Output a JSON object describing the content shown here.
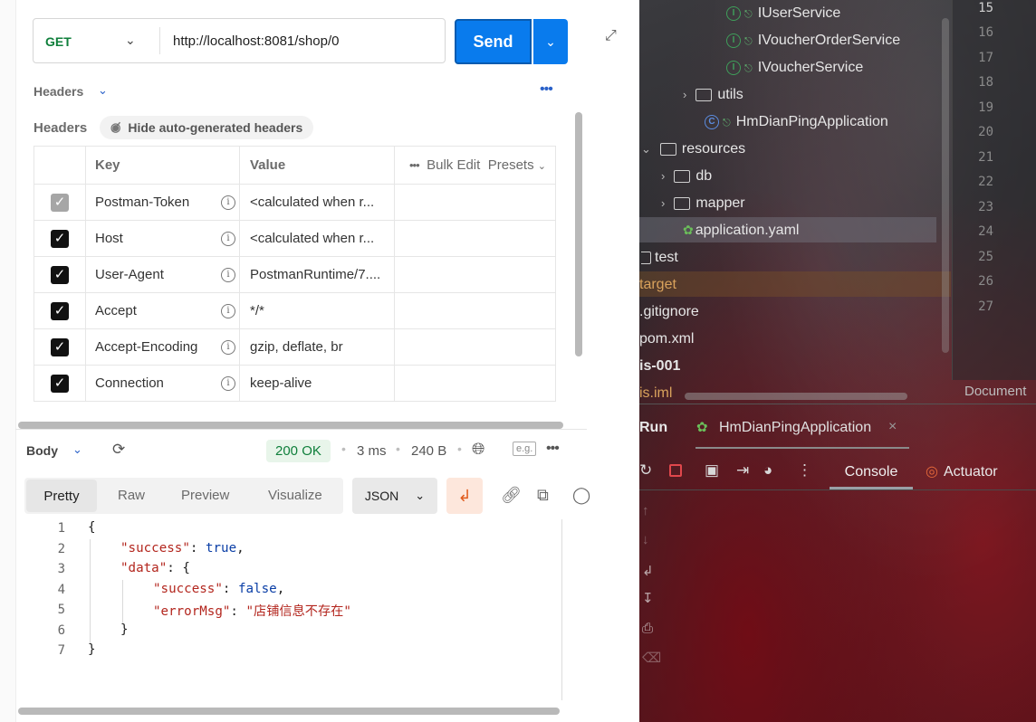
{
  "postman": {
    "request": {
      "method": "GET",
      "url": "http://localhost:8081/shop/0",
      "send_label": "Send"
    },
    "headers_section": {
      "title": "Headers",
      "sub_title": "Headers",
      "hide_auto_label": "Hide auto-generated headers",
      "col_key": "Key",
      "col_value": "Value",
      "bulk_edit": "Bulk Edit",
      "presets": "Presets",
      "rows": [
        {
          "key": "Postman-Token",
          "value": "<calculated when r...",
          "checked": true,
          "disabled": true
        },
        {
          "key": "Host",
          "value": "<calculated when r...",
          "checked": true,
          "disabled": false
        },
        {
          "key": "User-Agent",
          "value": "PostmanRuntime/7....",
          "checked": true,
          "disabled": false
        },
        {
          "key": "Accept",
          "value": "*/*",
          "checked": true,
          "disabled": false
        },
        {
          "key": "Accept-Encoding",
          "value": "gzip, deflate, br",
          "checked": true,
          "disabled": false
        },
        {
          "key": "Connection",
          "value": "keep-alive",
          "checked": true,
          "disabled": false
        }
      ]
    },
    "response": {
      "body_label": "Body",
      "status": "200 OK",
      "time": "3 ms",
      "size": "240 B",
      "eg_label": "e.g.",
      "view_tabs": [
        "Pretty",
        "Raw",
        "Preview",
        "Visualize"
      ],
      "active_view": "Pretty",
      "format": "JSON",
      "code_lines": [
        {
          "n": "1"
        },
        {
          "n": "2"
        },
        {
          "n": "3"
        },
        {
          "n": "4"
        },
        {
          "n": "5"
        },
        {
          "n": "6"
        },
        {
          "n": "7"
        }
      ],
      "json": {
        "open": "{",
        "success_key": "\"success\"",
        "success_val": "true",
        "data_key": "\"data\"",
        "data_open": "{",
        "inner_success_key": "\"success\"",
        "inner_success_val": "false",
        "error_key": "\"errorMsg\"",
        "error_val": "\"店铺信息不存在\"",
        "data_close": "}",
        "close": "}"
      }
    }
  },
  "ide": {
    "tree": [
      {
        "label": "IUserService"
      },
      {
        "label": "IVoucherOrderService"
      },
      {
        "label": "IVoucherService"
      },
      {
        "label": "utils"
      },
      {
        "label": "HmDianPingApplication"
      },
      {
        "label": "resources"
      },
      {
        "label": "db"
      },
      {
        "label": "mapper"
      },
      {
        "label": "application.yaml"
      },
      {
        "label": "test"
      },
      {
        "label": "target"
      },
      {
        "label": ".gitignore"
      },
      {
        "label": "pom.xml"
      },
      {
        "label": "is-001"
      },
      {
        "label": "is.iml"
      }
    ],
    "line_numbers": [
      "15",
      "16",
      "17",
      "18",
      "19",
      "20",
      "21",
      "22",
      "23",
      "24",
      "25",
      "26",
      "27"
    ],
    "document_label": "Document",
    "run": {
      "label": "Run",
      "config_name": "HmDianPingApplication",
      "console_tab": "Console",
      "actuator_tab": "Actuator"
    }
  }
}
